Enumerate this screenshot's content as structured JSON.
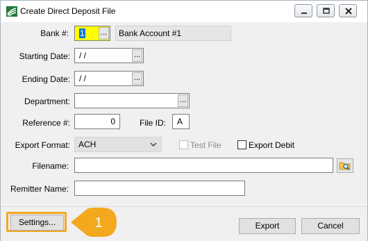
{
  "window": {
    "title": "Create Direct Deposit File"
  },
  "form": {
    "bank": {
      "label": "Bank #:",
      "value": "1",
      "account_name": "Bank Account #1"
    },
    "starting_date": {
      "label": "Starting Date:",
      "value": " /  /"
    },
    "ending_date": {
      "label": "Ending Date:",
      "value": " /  /"
    },
    "department": {
      "label": "Department:",
      "value": ""
    },
    "reference": {
      "label": "Reference #:",
      "value": "0"
    },
    "file_id": {
      "label": "File ID:",
      "value": "A"
    },
    "export_format": {
      "label": "Export Format:",
      "value": "ACH"
    },
    "test_file": {
      "label": "Test File",
      "checked": false,
      "enabled": false
    },
    "export_debit": {
      "label": "Export Debit",
      "checked": false
    },
    "filename": {
      "label": "Filename:",
      "value": ""
    },
    "remitter_name": {
      "label": "Remitter Name:",
      "value": ""
    },
    "ellipsis_label": "..."
  },
  "footer": {
    "settings_label": "Settings...",
    "export_label": "Export",
    "cancel_label": "Cancel",
    "callout_number": "1"
  },
  "colors": {
    "highlight": "#f3a81d",
    "bank_field_bg": "#ffff00",
    "selection": "#0078d7"
  }
}
